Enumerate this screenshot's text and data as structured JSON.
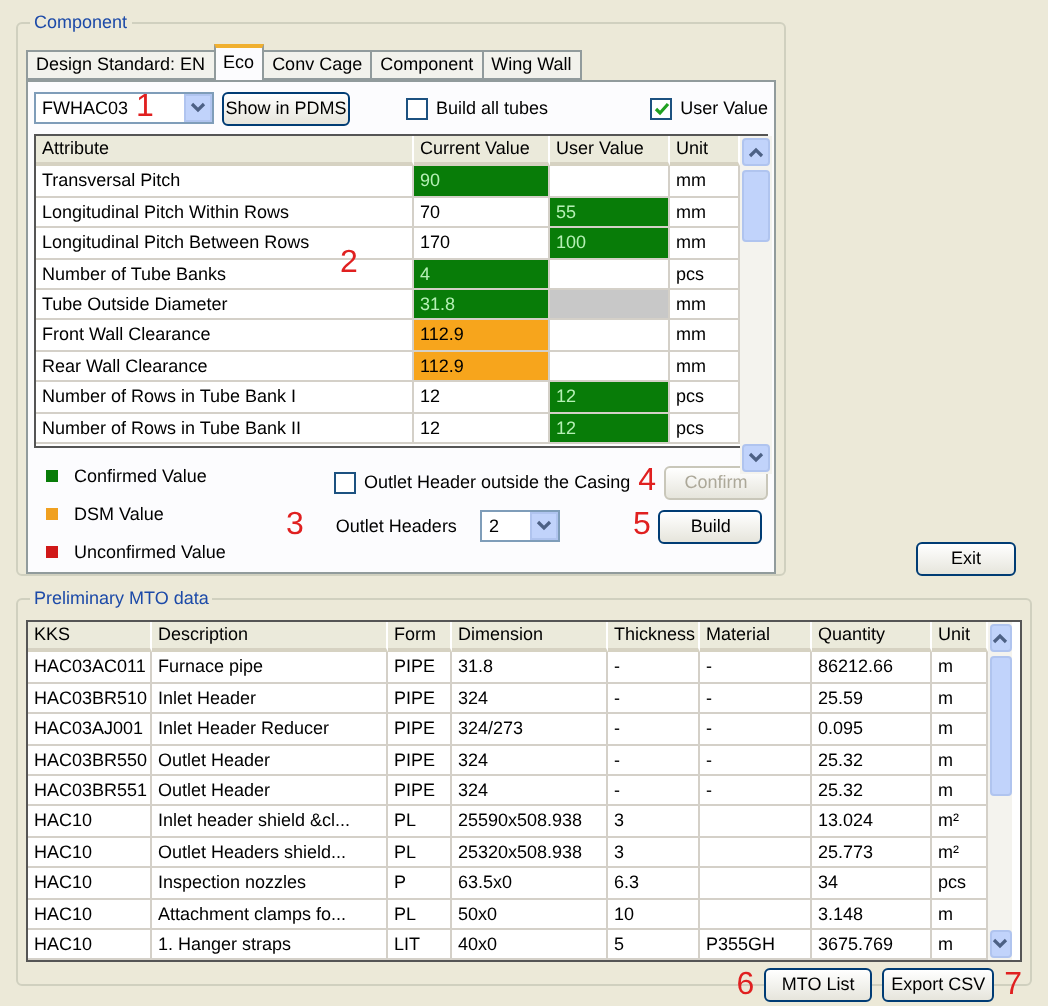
{
  "component": {
    "title": "Component",
    "tabs": [
      {
        "label": "Design Standard: EN",
        "selected": false
      },
      {
        "label": "Eco",
        "selected": true
      },
      {
        "label": "Conv Cage",
        "selected": false
      },
      {
        "label": "Component",
        "selected": false
      },
      {
        "label": "Wing Wall",
        "selected": false
      }
    ],
    "component_select": {
      "value": "FWHAC03"
    },
    "show_button": "Show in PDMS",
    "build_all_tubes": {
      "label": "Build all tubes",
      "checked": false
    },
    "user_value": {
      "label": "User Value",
      "checked": true
    },
    "attributes": {
      "columns": [
        "Attribute",
        "Current Value",
        "User Value",
        "Unit"
      ],
      "rows": [
        {
          "attribute": "Transversal Pitch",
          "current": {
            "text": "90",
            "color": "#087c08"
          },
          "user": {},
          "unit": "mm"
        },
        {
          "attribute": "Longitudinal Pitch Within Rows",
          "current": {
            "text": "70"
          },
          "user": {
            "text": "55",
            "color": "#087c08"
          },
          "unit": "mm"
        },
        {
          "attribute": "Longitudinal Pitch Between Rows",
          "current": {
            "text": "170"
          },
          "user": {
            "text": "100",
            "color": "#087c08"
          },
          "unit": "mm"
        },
        {
          "attribute": "Number of Tube Banks",
          "current": {
            "text": "4",
            "color": "#087c08"
          },
          "user": {},
          "unit": "pcs"
        },
        {
          "attribute": "Tube Outside Diameter",
          "current": {
            "text": "31.8",
            "color": "#087c08"
          },
          "user": {
            "disabled": true
          },
          "unit": "mm"
        },
        {
          "attribute": "Front Wall Clearance",
          "current": {
            "text": "112.9",
            "color": "#f7a51c"
          },
          "user": {},
          "unit": "mm"
        },
        {
          "attribute": "Rear Wall Clearance",
          "current": {
            "text": "112.9",
            "color": "#f7a51c"
          },
          "user": {},
          "unit": "mm"
        },
        {
          "attribute": "Number of Rows in Tube Bank I",
          "current": {
            "text": "12"
          },
          "user": {
            "text": "12",
            "color": "#087c08"
          },
          "unit": "pcs"
        },
        {
          "attribute": "Number of Rows in Tube Bank II",
          "current": {
            "text": "12"
          },
          "user": {
            "text": "12",
            "color": "#087c08"
          },
          "unit": "pcs"
        }
      ]
    },
    "legend": [
      {
        "label": "Confirmed Value",
        "color": "#087c08"
      },
      {
        "label": "DSM Value",
        "color": "#f0a020"
      },
      {
        "label": "Unconfirmed Value",
        "color": "#d01818"
      }
    ],
    "outlet_outside": {
      "label": "Outlet Header outside the Casing",
      "checked": false
    },
    "confirm_button": {
      "label": "Confirm",
      "disabled": true
    },
    "outlet_headers": {
      "label": "Outlet Headers",
      "value": "2"
    },
    "build_button": "Build"
  },
  "exit_button": "Exit",
  "mto": {
    "title": "Preliminary MTO data",
    "columns": [
      "KKS",
      "Description",
      "Form",
      "Dimension",
      "Thickness",
      "Material",
      "Quantity",
      "Unit"
    ],
    "rows": [
      [
        "HAC03AC011",
        "Furnace pipe",
        "PIPE",
        "31.8",
        "-",
        "-",
        "86212.66",
        "m"
      ],
      [
        "HAC03BR510",
        "Inlet Header",
        "PIPE",
        "324",
        "-",
        "-",
        "25.59",
        "m"
      ],
      [
        "HAC03AJ001",
        "Inlet Header Reducer",
        "PIPE",
        "324/273",
        "-",
        "-",
        "0.095",
        "m"
      ],
      [
        "HAC03BR550",
        "Outlet Header",
        "PIPE",
        "324",
        "-",
        "-",
        "25.32",
        "m"
      ],
      [
        "HAC03BR551",
        "Outlet Header",
        "PIPE",
        "324",
        "-",
        "-",
        "25.32",
        "m"
      ],
      [
        "HAC10",
        "Inlet header shield &cl...",
        "PL",
        "25590x508.938",
        "3",
        "",
        "13.024",
        "m²"
      ],
      [
        "HAC10",
        "Outlet Headers shield...",
        "PL",
        "25320x508.938",
        "3",
        "",
        "25.773",
        "m²"
      ],
      [
        "HAC10",
        "Inspection nozzles",
        "P",
        "63.5x0",
        "6.3",
        "",
        "34",
        "pcs"
      ],
      [
        "HAC10",
        "Attachment clamps fo...",
        "PL",
        "50x0",
        "10",
        "",
        "3.148",
        "m"
      ],
      [
        "HAC10",
        "1. Hanger straps",
        "LIT",
        "40x0",
        "5",
        "P355GH",
        "3675.769",
        "m"
      ]
    ],
    "buttons": [
      "MTO List",
      "Export CSV"
    ]
  },
  "annotations": [
    "1",
    "2",
    "3",
    "4",
    "5",
    "6",
    "7"
  ]
}
